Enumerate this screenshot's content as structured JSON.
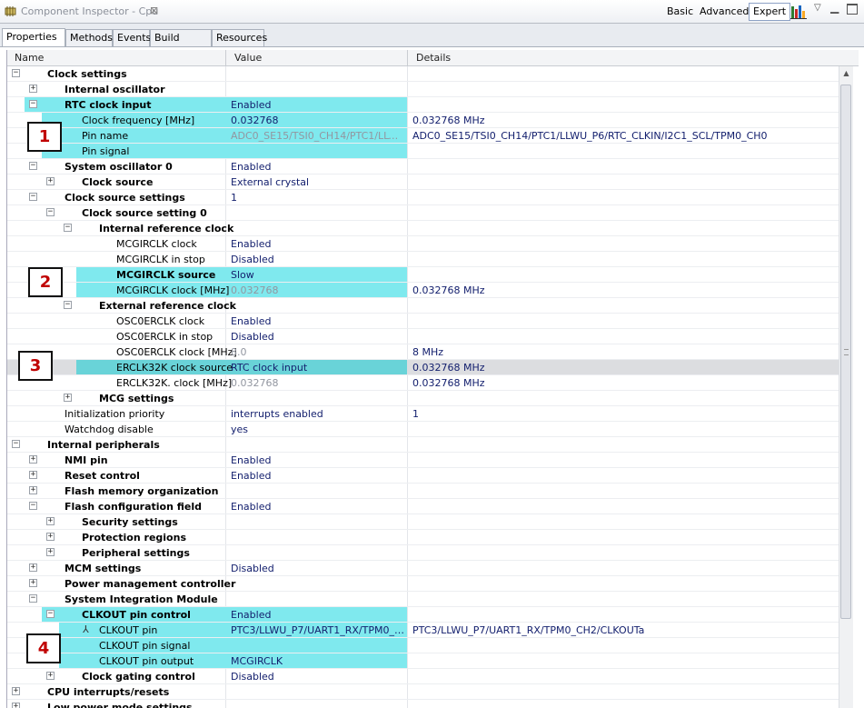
{
  "window": {
    "title": "Component Inspector - Cpu",
    "close_glyph": "⊠",
    "modes": [
      "Basic",
      "Advanced",
      "Expert"
    ],
    "active_mode": "Expert"
  },
  "tabs": [
    {
      "label": "Properties",
      "active": true
    },
    {
      "label": "Methods",
      "active": false
    },
    {
      "label": "Events",
      "active": false
    },
    {
      "label": "Build options",
      "active": false
    },
    {
      "label": "Resources",
      "active": false
    }
  ],
  "columns": {
    "name": "Name",
    "value": "Value",
    "details": "Details"
  },
  "colors": {
    "highlight": "#7fe9ee",
    "selected_row": "#dcdde0",
    "value_text": "#14206e",
    "callout_text": "#c00000"
  },
  "rows": [
    {
      "label": "Clock settings",
      "level": 0,
      "toggle": "minus",
      "bold": true,
      "value": "",
      "details": ""
    },
    {
      "label": "Internal oscillator",
      "level": 1,
      "toggle": "plus",
      "bold": true,
      "value": "",
      "details": ""
    },
    {
      "label": "RTC clock input",
      "level": 1,
      "toggle": "minus",
      "bold": true,
      "value": "Enabled",
      "details": "",
      "highlight": true
    },
    {
      "label": "Clock frequency [MHz]",
      "level": 2,
      "toggle": null,
      "bold": false,
      "value": "0.032768",
      "details": "0.032768 MHz",
      "highlight": true
    },
    {
      "label": "Pin name",
      "level": 2,
      "toggle": null,
      "bold": false,
      "value": "ADC0_SE15/TSI0_CH14/PTC1/LLWU...",
      "dim": true,
      "details": "ADC0_SE15/TSI0_CH14/PTC1/LLWU_P6/RTC_CLKIN/I2C1_SCL/TPM0_CH0",
      "highlight": true
    },
    {
      "label": "Pin signal",
      "level": 2,
      "toggle": null,
      "bold": false,
      "value": "",
      "details": "",
      "highlight": true
    },
    {
      "label": "System oscillator 0",
      "level": 1,
      "toggle": "minus",
      "bold": true,
      "value": "Enabled",
      "details": ""
    },
    {
      "label": "Clock source",
      "level": 2,
      "toggle": "plus",
      "bold": true,
      "value": "External crystal",
      "details": ""
    },
    {
      "label": "Clock source settings",
      "level": 1,
      "toggle": "minus",
      "bold": true,
      "value": "1",
      "details": ""
    },
    {
      "label": "Clock source setting 0",
      "level": 2,
      "toggle": "minus",
      "bold": true,
      "value": "",
      "details": ""
    },
    {
      "label": "Internal reference clock",
      "level": 3,
      "toggle": "minus",
      "bold": true,
      "value": "",
      "details": ""
    },
    {
      "label": "MCGIRCLK clock",
      "level": 4,
      "toggle": null,
      "bold": false,
      "value": "Enabled",
      "details": ""
    },
    {
      "label": "MCGIRCLK in stop",
      "level": 4,
      "toggle": null,
      "bold": false,
      "value": "Disabled",
      "details": ""
    },
    {
      "label": "MCGIRCLK source",
      "level": 4,
      "toggle": null,
      "bold": true,
      "value": "Slow",
      "details": "",
      "highlight": true
    },
    {
      "label": "MCGIRCLK clock [MHz]",
      "level": 4,
      "toggle": null,
      "bold": false,
      "value": "0.032768",
      "dim": true,
      "details": "0.032768 MHz",
      "highlight": true
    },
    {
      "label": "External reference clock",
      "level": 3,
      "toggle": "minus",
      "bold": true,
      "value": "",
      "details": ""
    },
    {
      "label": "OSC0ERCLK clock",
      "level": 4,
      "toggle": null,
      "bold": false,
      "value": "Enabled",
      "details": ""
    },
    {
      "label": "OSC0ERCLK in stop",
      "level": 4,
      "toggle": null,
      "bold": false,
      "value": "Disabled",
      "details": ""
    },
    {
      "label": "OSC0ERCLK clock [MHz]",
      "level": 4,
      "toggle": null,
      "bold": false,
      "value": "8.0",
      "dim": true,
      "details": "8 MHz"
    },
    {
      "label": "ERCLK32K clock source",
      "level": 4,
      "toggle": null,
      "bold": false,
      "value": "RTC clock input",
      "details": "0.032768 MHz",
      "highlight": true,
      "selected": true
    },
    {
      "label": "ERCLK32K. clock [MHz]",
      "level": 4,
      "toggle": null,
      "bold": false,
      "value": "0.032768",
      "dim": true,
      "details": "0.032768 MHz"
    },
    {
      "label": "MCG settings",
      "level": 3,
      "toggle": "plus",
      "bold": true,
      "value": "",
      "details": ""
    },
    {
      "label": "Initialization priority",
      "level": 1,
      "toggle": null,
      "bold": false,
      "value": "interrupts enabled",
      "details": "1"
    },
    {
      "label": "Watchdog disable",
      "level": 1,
      "toggle": null,
      "bold": false,
      "value": "yes",
      "details": ""
    },
    {
      "label": "Internal peripherals",
      "level": 0,
      "toggle": "minus",
      "bold": true,
      "value": "",
      "details": ""
    },
    {
      "label": "NMI pin",
      "level": 1,
      "toggle": "plus",
      "bold": true,
      "value": "Enabled",
      "details": ""
    },
    {
      "label": "Reset control",
      "level": 1,
      "toggle": "plus",
      "bold": true,
      "value": "Enabled",
      "details": ""
    },
    {
      "label": "Flash memory organization",
      "level": 1,
      "toggle": "plus",
      "bold": true,
      "value": "",
      "details": ""
    },
    {
      "label": "Flash configuration field",
      "level": 1,
      "toggle": "minus",
      "bold": true,
      "value": "Enabled",
      "details": ""
    },
    {
      "label": "Security settings",
      "level": 2,
      "toggle": "plus",
      "bold": true,
      "value": "",
      "details": ""
    },
    {
      "label": "Protection regions",
      "level": 2,
      "toggle": "plus",
      "bold": true,
      "value": "",
      "details": ""
    },
    {
      "label": "Peripheral settings",
      "level": 2,
      "toggle": "plus",
      "bold": true,
      "value": "",
      "details": ""
    },
    {
      "label": "MCM settings",
      "level": 1,
      "toggle": "plus",
      "bold": true,
      "value": "Disabled",
      "details": ""
    },
    {
      "label": "Power management controller",
      "level": 1,
      "toggle": "plus",
      "bold": true,
      "value": "",
      "details": ""
    },
    {
      "label": "System Integration Module",
      "level": 1,
      "toggle": "minus",
      "bold": true,
      "value": "",
      "details": ""
    },
    {
      "label": "CLKOUT pin control",
      "level": 2,
      "toggle": "minus",
      "bold": true,
      "value": "Enabled",
      "details": "",
      "highlight": true
    },
    {
      "label": "CLKOUT pin",
      "level": 3,
      "toggle": null,
      "bold": false,
      "pin_icon": true,
      "value": "PTC3/LLWU_P7/UART1_RX/TPM0_CH...",
      "details": "PTC3/LLWU_P7/UART1_RX/TPM0_CH2/CLKOUTa",
      "highlight": true
    },
    {
      "label": "CLKOUT pin signal",
      "level": 3,
      "toggle": null,
      "bold": false,
      "value": "",
      "details": "",
      "highlight": true
    },
    {
      "label": "CLKOUT pin output",
      "level": 3,
      "toggle": null,
      "bold": false,
      "value": "MCGIRCLK",
      "details": "",
      "highlight": true
    },
    {
      "label": "Clock gating control",
      "level": 2,
      "toggle": "plus",
      "bold": true,
      "value": "Disabled",
      "details": ""
    },
    {
      "label": "CPU interrupts/resets",
      "level": 0,
      "toggle": "plus",
      "bold": true,
      "value": "",
      "details": ""
    },
    {
      "label": "Low power mode settings",
      "level": 0,
      "toggle": "plus",
      "bold": true,
      "value": "",
      "details": ""
    }
  ],
  "callouts": [
    "1",
    "2",
    "3",
    "4"
  ]
}
